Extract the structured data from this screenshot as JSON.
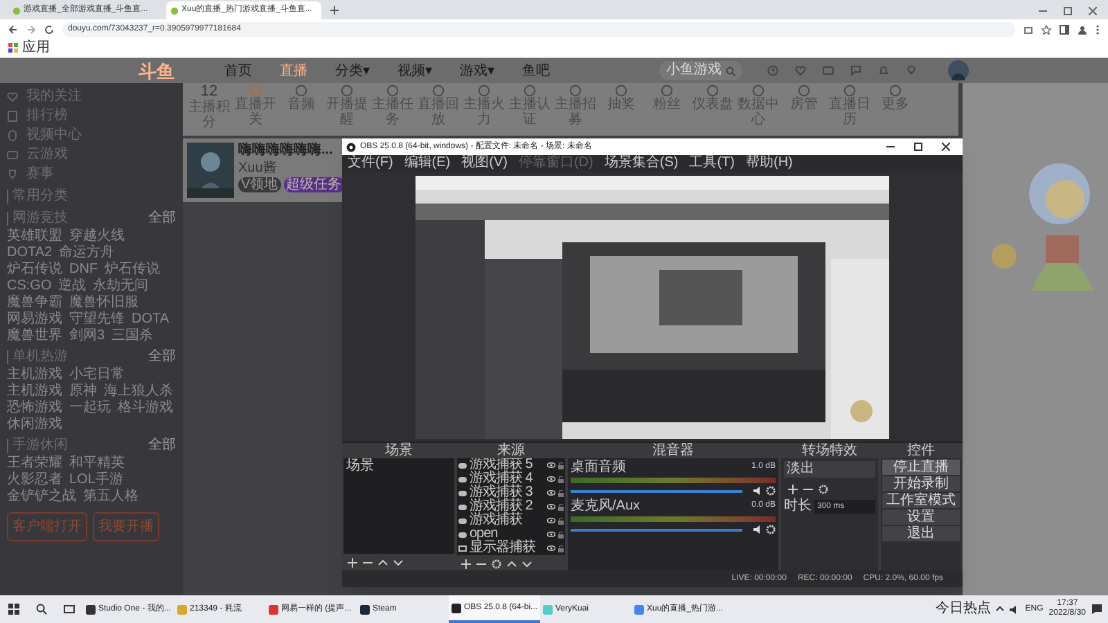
{
  "browser": {
    "tabs": [
      {
        "title": "游戏直播_全部游戏直播_斗鱼直...",
        "selected": false
      },
      {
        "title": "Xuu的直播_热门游戏直播_斗鱼直...",
        "selected": true
      }
    ],
    "url": "douyu.com/73043237_r=0.3905979977181684",
    "bookmarks": [
      "应用"
    ]
  },
  "site": {
    "logo": "斗鱼",
    "nav": [
      {
        "label": "首页",
        "selected": false
      },
      {
        "label": "直播",
        "selected": true
      },
      {
        "label": "分类▾",
        "selected": false
      },
      {
        "label": "视频▾",
        "selected": false
      },
      {
        "label": "游戏▾",
        "selected": false
      },
      {
        "label": "鱼吧",
        "selected": false
      }
    ],
    "search": {
      "placeholder": "小鱼游戏"
    }
  },
  "sidebar": {
    "items": [
      "我的关注",
      "排行榜",
      "视频中心",
      "云游戏",
      "赛事"
    ],
    "sections": [
      {
        "title": "常用分类"
      },
      {
        "title": "网游竞技",
        "more": "全部",
        "games": [
          "英雄联盟",
          "穿越火线",
          "DOTA2",
          "命运方舟",
          "炉石传说",
          "DNF",
          "炉石传说",
          "CS:GO",
          "逆战",
          "永劫无间",
          "魔兽争霸",
          "魔兽怀旧服",
          "网易游戏",
          "守望先锋",
          "DOTA",
          "魔兽世界",
          "剑网3",
          "三国杀"
        ]
      },
      {
        "title": "单机热游",
        "more": "全部",
        "games": [
          "主机游戏",
          "小宅日常",
          "主机游戏",
          "原神",
          "海上狼人杀",
          "恐怖游戏",
          "一起玩",
          "格斗游戏",
          "休闲游戏"
        ]
      },
      {
        "title": "手游休闲",
        "more": "全部",
        "games": [
          "王者荣耀",
          "和平精英",
          "火影忍者",
          "LOL手游",
          "金铲铲之战",
          "第五人格"
        ]
      }
    ],
    "buttons": [
      "客户端打开",
      "我要开播"
    ]
  },
  "stats": {
    "score": "12",
    "items": [
      "主播积分",
      "直播开关",
      "音频",
      "开播提醒",
      "主播任务",
      "直播回放",
      "主播火力",
      "主播认证",
      "主播招募",
      "抽奖",
      "粉丝",
      "仪表盘",
      "数据中心",
      "房管",
      "直播日历",
      "更多"
    ]
  },
  "profile": {
    "name": "嗨嗨嗨嗨嗨嗨...",
    "user": "Xuu酱",
    "badges": [
      "V领地",
      "超级任务"
    ]
  },
  "obs": {
    "title": "OBS 25.0.8 (64-bit, windows) - 配置文件: 未命名 - 场景: 未命名",
    "menu": [
      {
        "label": "文件(F)",
        "disabled": false
      },
      {
        "label": "编辑(E)",
        "disabled": false
      },
      {
        "label": "视图(V)",
        "disabled": false
      },
      {
        "label": "停靠窗口(D)",
        "disabled": true
      },
      {
        "label": "场景集合(S)",
        "disabled": false
      },
      {
        "label": "工具(T)",
        "disabled": false
      },
      {
        "label": "帮助(H)",
        "disabled": false
      }
    ],
    "docks": {
      "scenes": {
        "title": "场景",
        "items": [
          {
            "label": "场景",
            "selected": false
          }
        ]
      },
      "sources": {
        "title": "来源",
        "items": [
          {
            "label": "游戏捕获 5",
            "kind": "game"
          },
          {
            "label": "游戏捕获 4",
            "kind": "game"
          },
          {
            "label": "游戏捕获 3",
            "kind": "game"
          },
          {
            "label": "游戏捕获 2",
            "kind": "game"
          },
          {
            "label": "游戏捕获",
            "kind": "game"
          },
          {
            "label": "open",
            "kind": "game"
          },
          {
            "label": "显示器捕获",
            "kind": "display"
          }
        ]
      },
      "mixer": {
        "title": "混音器",
        "channels": [
          {
            "name": "桌面音频",
            "reading": "1.0 dB",
            "level": 0.95
          },
          {
            "name": "麦克风/Aux",
            "reading": "0.0 dB",
            "level": 0.95
          }
        ]
      },
      "transitions": {
        "title": "转场特效",
        "type": "淡出",
        "duration_label": "时长",
        "duration": "300 ms"
      },
      "controls": {
        "title": "控件",
        "buttons": [
          {
            "label": "停止直播",
            "active": true
          },
          {
            "label": "开始录制",
            "active": false
          },
          {
            "label": "工作室模式",
            "active": false
          },
          {
            "label": "设置",
            "active": false
          },
          {
            "label": "退出",
            "active": false
          }
        ]
      }
    },
    "status": [
      "LIVE: 00:00:00",
      "REC: 00:00:00",
      "CPU: 2.0%, 60.00 fps"
    ]
  },
  "taskbar": {
    "apps": [
      {
        "label": "Studio One - 我的...",
        "selected": false
      },
      {
        "label": "213349 - 耗流",
        "selected": false
      },
      {
        "label": "网易一样的 (提声...",
        "selected": false
      },
      {
        "label": "Steam",
        "selected": false
      },
      {
        "label": "OBS 25.0.8 (64-bi...",
        "selected": true
      },
      {
        "label": "VeryKuai",
        "selected": false
      },
      {
        "label": "Xuu的直播_热门游...",
        "selected": false
      }
    ],
    "tray": {
      "news": "今日热点",
      "lang": "ENG",
      "time": "17:37",
      "date": "2022/8/30"
    }
  }
}
